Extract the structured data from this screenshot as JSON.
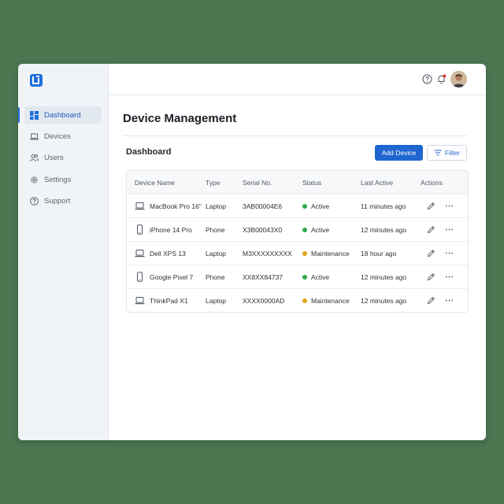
{
  "sidebar": {
    "logo_icon": "app-logo-icon",
    "items": [
      {
        "label": "Dashboard",
        "icon": "grid-icon",
        "active": true
      },
      {
        "label": "Devices",
        "icon": "laptop-icon"
      },
      {
        "label": "Users",
        "icon": "users-icon"
      },
      {
        "label": "Settings",
        "icon": "gear-icon"
      },
      {
        "label": "Support",
        "icon": "help-circle-icon"
      }
    ]
  },
  "topbar": {
    "icons": [
      "help-circle-icon",
      "bell-icon"
    ],
    "has_notification": true,
    "avatar": "user-avatar"
  },
  "main": {
    "page_title": "Device Management",
    "section_title": "Dashboard",
    "add_button": "Add Device",
    "filter_button": "Filter"
  },
  "table": {
    "columns": [
      "Device Name",
      "Type",
      "Serial No.",
      "Status",
      "Last Active",
      "Actions"
    ],
    "rows": [
      {
        "name": "MacBook Pro 16\"",
        "type": "Laptop",
        "serial": "3AB00004E6",
        "status": "Active",
        "last_active": "11 minutes ago",
        "icon": "laptop-icon"
      },
      {
        "name": "iPhone 14 Pro",
        "type": "Phone",
        "serial": "X3B00043X0",
        "status": "Active",
        "last_active": "12 minutes ago",
        "icon": "phone-icon"
      },
      {
        "name": "Dell XPS 13",
        "type": "Laptop",
        "serial": "M3XXXXXXXXX",
        "status": "Maintenance",
        "last_active": "18 hour ago",
        "icon": "laptop-icon"
      },
      {
        "name": "Google Pixel 7",
        "type": "Phone",
        "serial": "XX8XX84737",
        "status": "Active",
        "last_active": "12 minutes ago",
        "icon": "phone-icon"
      },
      {
        "name": "ThinkPad X1",
        "type": "Laptop",
        "serial": "XXXX0000AD",
        "status": "Maintenance",
        "last_active": "12 minutes ago",
        "icon": "laptop-icon"
      }
    ]
  },
  "colors": {
    "primary": "#1f66d1",
    "active_status": "#2eaa4f",
    "maintenance_status": "#e3a21a",
    "background": "#4a7650"
  }
}
